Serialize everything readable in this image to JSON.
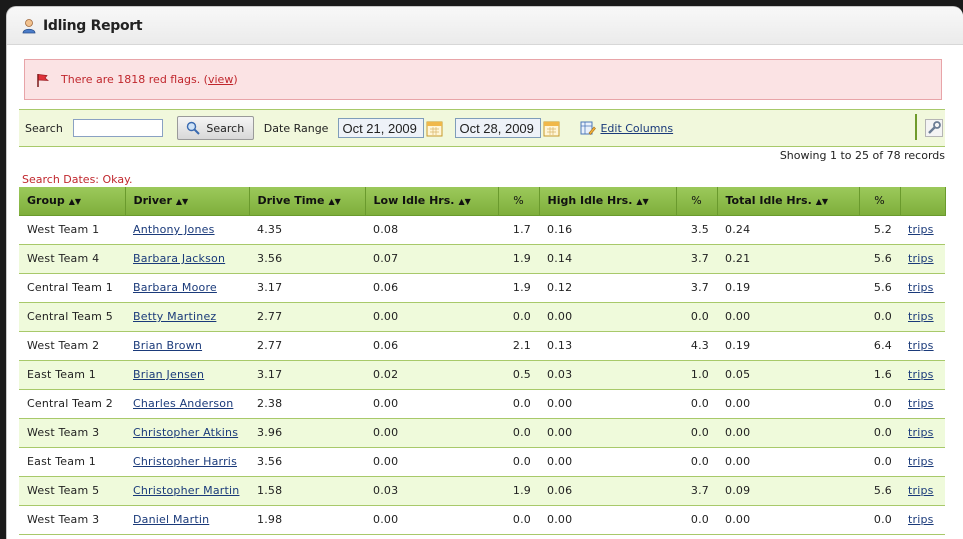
{
  "window": {
    "title": "Idling Report"
  },
  "alert": {
    "prefix": "There are 1818 red flags. (",
    "link": "view",
    "suffix": ")"
  },
  "toolbar": {
    "search_label": "Search",
    "search_value": "",
    "search_button": "Search",
    "date_range_label": "Date Range",
    "date_from": "Oct 21, 2009",
    "date_to": "Oct 28, 2009",
    "edit_columns": "Edit Columns"
  },
  "records": "Showing 1 to 25 of 78 records",
  "status": "Search Dates: Okay.",
  "table": {
    "headers": {
      "group": "Group",
      "driver": "Driver",
      "drive_time": "Drive Time",
      "low_idle": "Low Idle Hrs.",
      "low_pct": "%",
      "high_idle": "High Idle Hrs.",
      "high_pct": "%",
      "total_idle": "Total Idle Hrs.",
      "total_pct": "%"
    },
    "sort_icon": "sort-arrows",
    "rows": [
      [
        "West Team 1",
        "Anthony Jones",
        "4.35",
        "0.08",
        "1.7",
        "0.16",
        "3.5",
        "0.24",
        "5.2",
        "trips"
      ],
      [
        "West Team 4",
        "Barbara Jackson",
        "3.56",
        "0.07",
        "1.9",
        "0.14",
        "3.7",
        "0.21",
        "5.6",
        "trips"
      ],
      [
        "Central Team 1",
        "Barbara Moore",
        "3.17",
        "0.06",
        "1.9",
        "0.12",
        "3.7",
        "0.19",
        "5.6",
        "trips"
      ],
      [
        "Central Team 5",
        "Betty Martinez",
        "2.77",
        "0.00",
        "0.0",
        "0.00",
        "0.0",
        "0.00",
        "0.0",
        "trips"
      ],
      [
        "West Team 2",
        "Brian Brown",
        "2.77",
        "0.06",
        "2.1",
        "0.13",
        "4.3",
        "0.19",
        "6.4",
        "trips"
      ],
      [
        "East Team 1",
        "Brian Jensen",
        "3.17",
        "0.02",
        "0.5",
        "0.03",
        "1.0",
        "0.05",
        "1.6",
        "trips"
      ],
      [
        "Central Team 2",
        "Charles Anderson",
        "2.38",
        "0.00",
        "0.0",
        "0.00",
        "0.0",
        "0.00",
        "0.0",
        "trips"
      ],
      [
        "West Team 3",
        "Christopher Atkins",
        "3.96",
        "0.00",
        "0.0",
        "0.00",
        "0.0",
        "0.00",
        "0.0",
        "trips"
      ],
      [
        "East Team 1",
        "Christopher Harris",
        "3.56",
        "0.00",
        "0.0",
        "0.00",
        "0.0",
        "0.00",
        "0.0",
        "trips"
      ],
      [
        "West Team 5",
        "Christopher Martin",
        "1.58",
        "0.03",
        "1.9",
        "0.06",
        "3.7",
        "0.09",
        "5.6",
        "trips"
      ],
      [
        "West Team 3",
        "Daniel Martin",
        "1.98",
        "0.00",
        "0.0",
        "0.00",
        "0.0",
        "0.00",
        "0.0",
        "trips"
      ]
    ]
  },
  "colors": {
    "header_green": "#8fbe4b",
    "alt_row": "#effadb",
    "alert_red": "#c0272d",
    "link_blue": "#1a3a7a"
  }
}
